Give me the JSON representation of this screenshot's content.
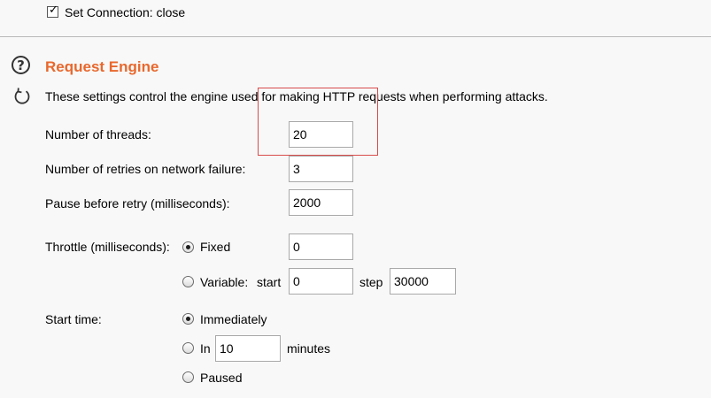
{
  "top_option": {
    "label": "Set Connection: close",
    "checked": true
  },
  "section": {
    "title": "Request Engine",
    "description": "These settings control the engine used for making HTTP requests when performing attacks."
  },
  "fields": {
    "threads": {
      "label": "Number of threads:",
      "value": "20"
    },
    "retries": {
      "label": "Number of retries on network failure:",
      "value": "3"
    },
    "pause": {
      "label": "Pause before retry (milliseconds):",
      "value": "2000"
    }
  },
  "throttle": {
    "label": "Throttle (milliseconds):",
    "fixed": {
      "label": "Fixed",
      "value": "0",
      "selected": true
    },
    "variable": {
      "label": "Variable:",
      "start_label": "start",
      "start_value": "0",
      "step_label": "step",
      "step_value": "30000",
      "selected": false
    }
  },
  "start_time": {
    "label": "Start time:",
    "immediately": {
      "label": "Immediately",
      "selected": true
    },
    "in": {
      "label": "In",
      "value": "10",
      "unit": "minutes",
      "selected": false
    },
    "paused": {
      "label": "Paused",
      "selected": false
    }
  },
  "icons": {
    "help": "help-icon",
    "refresh": "refresh-icon"
  },
  "colors": {
    "title": "#e8682d",
    "annotation_box": "#d94b4b"
  }
}
